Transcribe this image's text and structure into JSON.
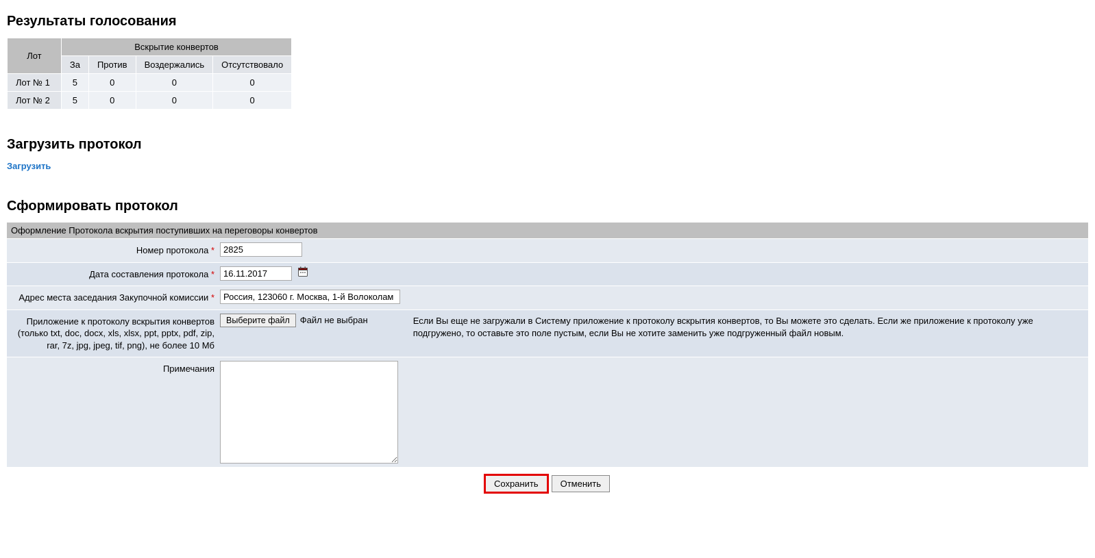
{
  "results": {
    "heading": "Результаты голосования",
    "col_lot": "Лот",
    "col_group": "Вскрытие конвертов",
    "col_for": "За",
    "col_against": "Против",
    "col_abstain": "Воздержались",
    "col_absent": "Отсутствовало",
    "rows": [
      {
        "lot": "Лот № 1",
        "for": "5",
        "against": "0",
        "abstain": "0",
        "absent": "0"
      },
      {
        "lot": "Лот № 2",
        "for": "5",
        "against": "0",
        "abstain": "0",
        "absent": "0"
      }
    ]
  },
  "upload": {
    "heading": "Загрузить протокол",
    "link": "Загрузить"
  },
  "form": {
    "heading": "Сформировать протокол",
    "header_bar": "Оформление Протокола вскрытия поступивших на переговоры конвертов",
    "number_label": "Номер протокола",
    "number_value": "2825",
    "date_label": "Дата составления протокола",
    "date_value": "16.11.2017",
    "address_label": "Адрес места заседания Закупочной комиссии",
    "address_value": "Россия, 123060 г. Москва, 1-й Волоколам",
    "attach_label": "Приложение к протоколу вскрытия конвертов (только txt, doc, docx, xls, xlsx, ppt, pptx, pdf, zip, rar, 7z, jpg, jpeg, tif, png), не более 10 Мб",
    "file_button": "Выберите файл",
    "file_status": "Файл не выбран",
    "attach_help": "Если Вы еще не загружали в Систему приложение к протоколу вскрытия конвертов, то Вы можете это сделать. Если же приложение к протоколу уже подгружено, то оставьте это поле пустым, если Вы не хотите заменить уже подгруженный файл новым.",
    "notes_label": "Примечания",
    "notes_value": "",
    "save": "Сохранить",
    "cancel": "Отменить",
    "required_mark": "*"
  }
}
